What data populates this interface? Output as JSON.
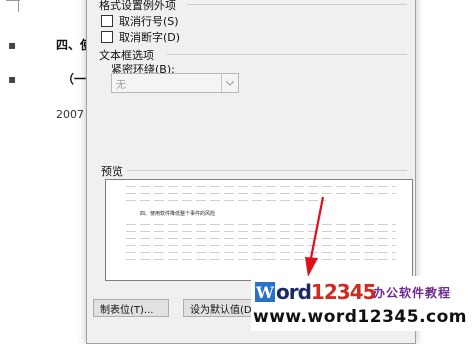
{
  "document": {
    "heading_text": "四、使",
    "subheading_text": "（一）",
    "year_text": "2007",
    "bullet_1": "▪",
    "bullet_2": "▪"
  },
  "dialog": {
    "section_format_exceptions": "格式设置例外项",
    "checkbox_suppress_line_numbers": "取消行号(S)",
    "checkbox_no_hyphenate": "取消断字(D)",
    "section_textbox_options": "文本框选项",
    "label_tight_wrap": "紧密环绕(B):",
    "tight_wrap_value": "无",
    "section_preview": "预览",
    "preview_sample_text": "四、使用软件降低整个事件的风险",
    "button_tabs": "制表位(T)...",
    "button_set_default": "设为默认值(D)"
  },
  "watermark": {
    "logo_letter": "W",
    "logo_word": "ord",
    "logo_digits": "12345",
    "tagline": "办公软件教程",
    "url": "www.word12345.com"
  },
  "colors": {
    "annotation_arrow": "#e0101a",
    "logo_blue": "#2a72c9",
    "logo_red": "#d22a1e"
  }
}
